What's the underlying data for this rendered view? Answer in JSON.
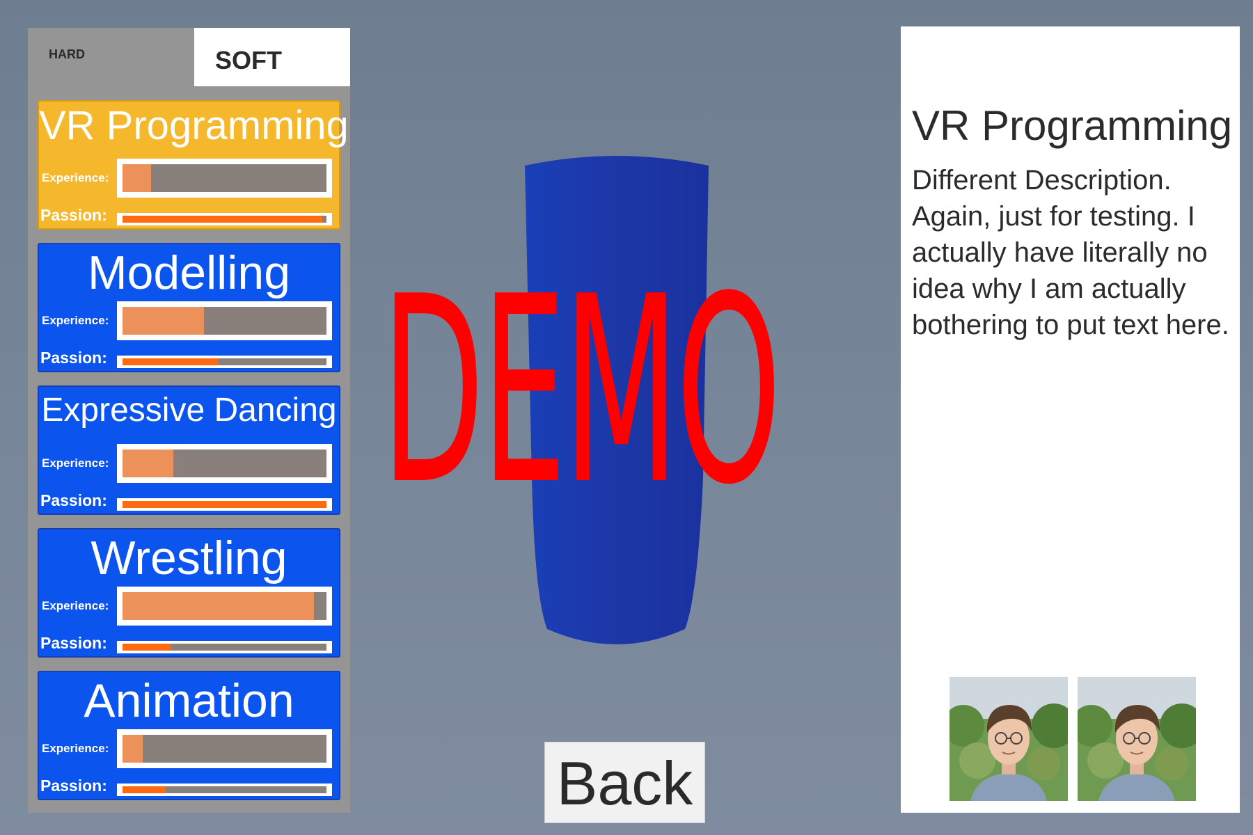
{
  "tabs": {
    "hard_label": "HARD",
    "soft_label": "SOFT"
  },
  "skills": [
    {
      "title": "VR Programming",
      "experience_label": "Experience:",
      "passion_label": "Passion:",
      "experience": 0.14,
      "passion": 0.98,
      "selected": true
    },
    {
      "title": "Modelling",
      "experience_label": "Experience:",
      "passion_label": "Passion:",
      "experience": 0.4,
      "passion": 0.47,
      "selected": false
    },
    {
      "title": "Expressive Dancing",
      "experience_label": "Experience:",
      "passion_label": "Passion:",
      "experience": 0.25,
      "passion": 1.0,
      "selected": false
    },
    {
      "title": "Wrestling",
      "experience_label": "Experience:",
      "passion_label": "Passion:",
      "experience": 0.94,
      "passion": 0.24,
      "selected": false
    },
    {
      "title": "Animation",
      "experience_label": "Experience:",
      "passion_label": "Passion:",
      "experience": 0.1,
      "passion": 0.21,
      "selected": false
    }
  ],
  "center": {
    "watermark": "DEMO",
    "back_label": "Back"
  },
  "info": {
    "title": "VR Programming",
    "description": "Different Description. Again, just for testing. I actually have literally no idea why I am actually bothering to put text here."
  },
  "colors": {
    "card_selected": "#f5b72b",
    "card_default": "#0b55ee",
    "experience_fill": "#ec915a",
    "passion_fill": "#ff6a10",
    "bar_track": "#8a807b",
    "watermark": "#ff0000",
    "cylinder": "#1b35a8"
  }
}
